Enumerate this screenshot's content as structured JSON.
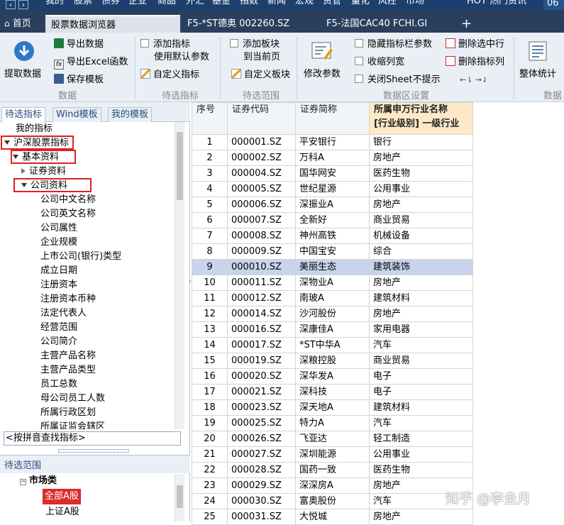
{
  "menubar": {
    "items": [
      "我的",
      "股票",
      "债券",
      "企业",
      "商品",
      "外汇",
      "基金",
      "指数",
      "新闻",
      "宏观",
      "资管",
      "量化",
      "风控",
      "市场"
    ],
    "hot": "HOT 热门资讯",
    "version": "06"
  },
  "tabs": {
    "home": "首页",
    "browser": "股票数据浏览器",
    "tab1": "F5-*ST德奥 002260.SZ",
    "tab2": "F5-法国CAC40 FCHI.GI",
    "add": "+"
  },
  "ribbon": {
    "extract": "提取数据",
    "export_data": "导出数据",
    "export_excel": "导出Excel函数",
    "save_template": "保存模板",
    "group_data": "数据",
    "add_indicator_l1": "添加指标",
    "add_indicator_l2": "使用默认参数",
    "custom_indicator": "自定义指标",
    "group_candidate_indicator": "待选指标",
    "add_sector_l1": "添加板块",
    "add_sector_l2": "到当前页",
    "custom_sector": "自定义板块",
    "group_candidate_range": "待选范围",
    "modify_params": "修改参数",
    "hide_params": "隐藏指标栏参数",
    "collapse_cols": "收缩列宽",
    "close_sheet": "关闭Sheet不提示",
    "delete_row": "删除选中行",
    "delete_col": "删除指标列",
    "group_area": "数据区设置",
    "overall_stats": "整体统计",
    "group_data2": "数据"
  },
  "left": {
    "tabs": [
      "待选指标",
      "Wind模板",
      "我的模板"
    ],
    "tree": {
      "my": "我的指标",
      "root": "沪深股票指标",
      "basic": "基本资料",
      "security": "证券资料",
      "company": "公司资料",
      "items": [
        "公司中文名称",
        "公司英文名称",
        "公司属性",
        "企业规模",
        "上市公司(银行)类型",
        "成立日期",
        "注册资本",
        "注册资本币种",
        "法定代表人",
        "经营范围",
        "公司简介",
        "主营产品名称",
        "主营产品类型",
        "员工总数",
        "母公司员工人数",
        "所属行政区划",
        "所属证监会辖区"
      ]
    },
    "search": "<按拼音查找指标>",
    "range": {
      "title": "待选范围",
      "market": "市场类",
      "items": [
        "全部A股",
        "上证A股"
      ]
    }
  },
  "grid": {
    "headers": [
      "序号",
      "证券代码",
      "证券简称",
      "所属申万行业名称",
      "[行业级别] 一级行业"
    ],
    "selected_row": 9,
    "rows": [
      [
        "1",
        "000001.SZ",
        "平安银行",
        "银行"
      ],
      [
        "2",
        "000002.SZ",
        "万科A",
        "房地产"
      ],
      [
        "3",
        "000004.SZ",
        "国华网安",
        "医药生物"
      ],
      [
        "4",
        "000005.SZ",
        "世纪星源",
        "公用事业"
      ],
      [
        "5",
        "000006.SZ",
        "深振业A",
        "房地产"
      ],
      [
        "6",
        "000007.SZ",
        "全新好",
        "商业贸易"
      ],
      [
        "7",
        "000008.SZ",
        "神州高铁",
        "机械设备"
      ],
      [
        "8",
        "000009.SZ",
        "中国宝安",
        "综合"
      ],
      [
        "9",
        "000010.SZ",
        "美丽生态",
        "建筑装饰"
      ],
      [
        "10",
        "000011.SZ",
        "深物业A",
        "房地产"
      ],
      [
        "11",
        "000012.SZ",
        "南玻A",
        "建筑材料"
      ],
      [
        "12",
        "000014.SZ",
        "沙河股份",
        "房地产"
      ],
      [
        "13",
        "000016.SZ",
        "深康佳A",
        "家用电器"
      ],
      [
        "14",
        "000017.SZ",
        "*ST中华A",
        "汽车"
      ],
      [
        "15",
        "000019.SZ",
        "深粮控股",
        "商业贸易"
      ],
      [
        "16",
        "000020.SZ",
        "深华发A",
        "电子"
      ],
      [
        "17",
        "000021.SZ",
        "深科技",
        "电子"
      ],
      [
        "18",
        "000023.SZ",
        "深天地A",
        "建筑材料"
      ],
      [
        "19",
        "000025.SZ",
        "特力A",
        "汽车"
      ],
      [
        "20",
        "000026.SZ",
        "飞亚达",
        "轻工制造"
      ],
      [
        "21",
        "000027.SZ",
        "深圳能源",
        "公用事业"
      ],
      [
        "22",
        "000028.SZ",
        "国药一致",
        "医药生物"
      ],
      [
        "23",
        "000029.SZ",
        "深深房A",
        "房地产"
      ],
      [
        "24",
        "000030.SZ",
        "富奥股份",
        "汽车"
      ],
      [
        "25",
        "000031.SZ",
        "大悦城",
        "房地产"
      ]
    ]
  },
  "watermark": "知乎 @李圭月",
  "colors": {
    "menubar": "#1c3f6e",
    "tabbar": "#2a3f5e",
    "selected_row": "#c7d4eb",
    "header_highlight": "#fde9c8",
    "red_box": "#e02020"
  }
}
